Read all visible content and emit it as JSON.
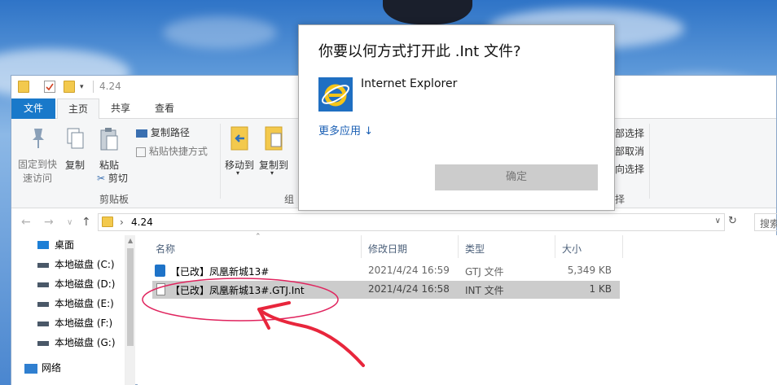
{
  "window": {
    "title": "4.24"
  },
  "ribbon": {
    "tabs": [
      "文件",
      "主页",
      "共享",
      "查看"
    ],
    "pin_label": "固定到快速访问",
    "pin_label_line1": "固定到快",
    "pin_label_line2": "速访问",
    "copy_label": "复制",
    "paste_label": "粘贴",
    "copy_path_label": "复制路径",
    "paste_shortcut_label": "粘贴快捷方式",
    "cut_label": "剪切",
    "clipboard_group": "剪贴板",
    "move_to_label": "移动到",
    "copy_to_label": "复制到",
    "organize_group_partial": "组",
    "select_all_partial": "部选择",
    "select_none_partial": "部取消",
    "invert_partial": "向选择",
    "select_group_partial": "择"
  },
  "address": {
    "path": "4.24",
    "search_placeholder": "搜索"
  },
  "nav": {
    "items": [
      {
        "label": "桌面",
        "icon": "desktop-icon"
      },
      {
        "label": "本地磁盘 (C:)",
        "icon": "drive-icon"
      },
      {
        "label": "本地磁盘 (D:)",
        "icon": "drive-icon"
      },
      {
        "label": "本地磁盘 (E:)",
        "icon": "drive-icon"
      },
      {
        "label": "本地磁盘 (F:)",
        "icon": "drive-icon"
      },
      {
        "label": "本地磁盘 (G:)",
        "icon": "drive-icon"
      },
      {
        "label": "网络",
        "icon": "network-icon"
      }
    ]
  },
  "list": {
    "columns": [
      "名称",
      "修改日期",
      "类型",
      "大小"
    ],
    "rows": [
      {
        "name": "【已改】凤凰新城13#",
        "date": "2021/4/24 16:59",
        "type": "GTJ 文件",
        "size": "5,349 KB",
        "selected": false
      },
      {
        "name": "【已改】凤凰新城13#.GTJ.Int",
        "date": "2021/4/24 16:58",
        "type": "INT 文件",
        "size": "1 KB",
        "selected": true
      }
    ]
  },
  "dialog": {
    "title": "你要以何方式打开此 .Int 文件?",
    "app_name": "Internet Explorer",
    "more_apps": "更多应用 ↓",
    "ok_label": "确定"
  },
  "colors": {
    "accent": "#1979ca",
    "link": "#1a5fb4",
    "annotation": "#e0245e",
    "selection": "#cccccc"
  }
}
